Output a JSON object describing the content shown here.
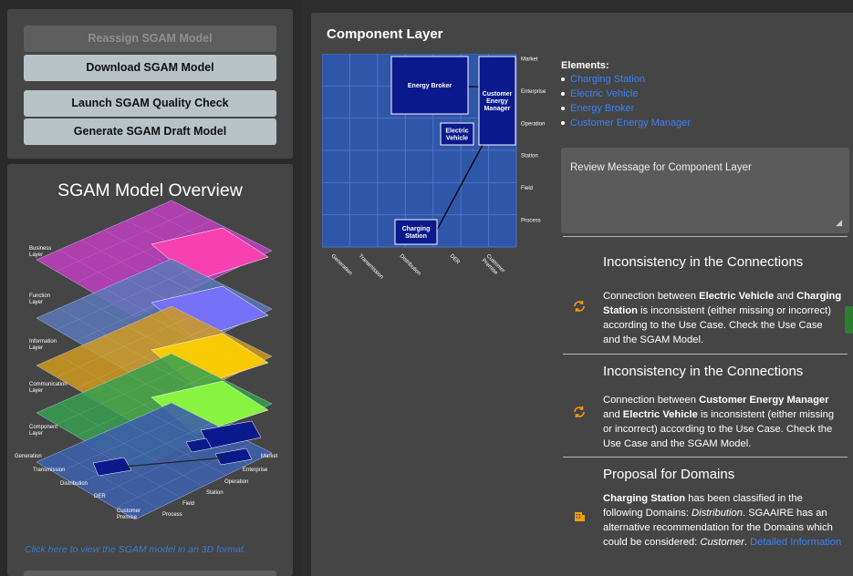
{
  "buttons": {
    "reassign": "Reassign SGAM Model",
    "download": "Download SGAM Model",
    "quality_check": "Launch SGAM Quality Check",
    "generate": "Generate SGAM Draft Model"
  },
  "overview": {
    "title": "SGAM Model Overview",
    "link": "Click here to view the SGAM model in an 3D format.",
    "layers": [
      "Business\nLayer",
      "Function\nLayer",
      "Information\nLayer",
      "Communication\nLayer",
      "Component\nLayer"
    ],
    "domains": [
      "Generation",
      "Transmission",
      "Distribution",
      "DER",
      "Customer\nPremise"
    ],
    "zones": [
      "Market",
      "Enterprise",
      "Operation",
      "Station",
      "Field",
      "Process"
    ]
  },
  "component": {
    "title": "Component Layer",
    "zones": [
      "Market",
      "Enterprise",
      "Operation",
      "Station",
      "Field",
      "Process"
    ],
    "domains": [
      "Generation",
      "Transmission",
      "Distribution",
      "DER",
      "Customer\nPremise"
    ],
    "boxes": {
      "energy_broker": "Energy Broker",
      "cem": "Customer\nEnergy\nManager",
      "ev": "Electric\nVehicle",
      "cs": "Charging\nStation"
    }
  },
  "elements": {
    "heading": "Elements:",
    "items": [
      "Charging Station",
      "Electric Vehicle",
      "Energy Broker",
      "Customer Energy Manager"
    ]
  },
  "review": {
    "placeholder": "Review Message for Component Layer"
  },
  "cards": [
    {
      "title": "Inconsistency in the Connections",
      "text_1": "Connection between ",
      "bold_1": "Electric Vehicle",
      "text_2": " and ",
      "bold_2": "Charging Station",
      "text_3": " is inconsistent (either missing or incorrect) according to the Use Case. Check the Use Case and the SGAM Model."
    },
    {
      "title": "Inconsistency in the Connections",
      "text_1": "Connection between ",
      "bold_1": "Customer Energy Manager",
      "text_2": " and ",
      "bold_2": "Electric Vehicle",
      "text_3": " is inconsistent (either missing or incorrect) according to the Use Case. Check the Use Case and the SGAM Model."
    },
    {
      "title": "Proposal for Domains",
      "bold_1": "Charging Station",
      "text_1": " has been classified in the following Domains: ",
      "ital_1": "Distribution",
      "text_2": ". SGAAIRE has an alternative recommendation for the Domains which could be considered: ",
      "ital_2": "Customer",
      "text_3": ". ",
      "link": "Detailed Information"
    }
  ],
  "colors": {
    "accent": "#3b82f6",
    "warning_icon": "#f39c12"
  }
}
